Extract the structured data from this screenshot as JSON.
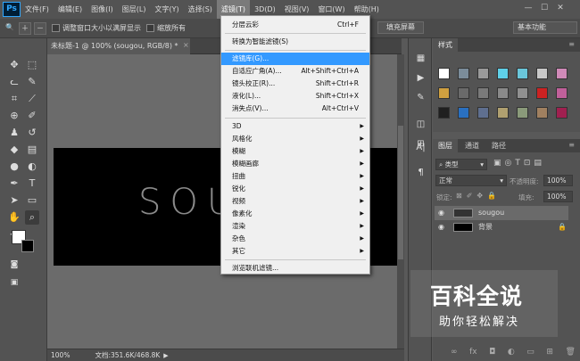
{
  "app": {
    "logo": "Ps"
  },
  "menubar": {
    "items": [
      "文件(F)",
      "编辑(E)",
      "图像(I)",
      "图层(L)",
      "文字(Y)",
      "选择(S)",
      "滤镜(T)",
      "3D(D)",
      "视图(V)",
      "窗口(W)",
      "帮助(H)"
    ],
    "active_index": 6,
    "window_controls": [
      "—",
      "☐",
      "✕"
    ]
  },
  "options_bar": {
    "zoom_glyph": "🔍",
    "resize_windows_label": "调整窗口大小以满屏显示",
    "zoom_all_label": "缩放所有",
    "fill_screen_button": "填充屏幕",
    "workspace_select": "基本功能"
  },
  "document": {
    "tab_title": "未标题-1 @ 100% (sougou, RGB/8) *",
    "canvas_text": "SOU",
    "zoom_status": "100%",
    "doc_status": "文档:351.6K/468.8K"
  },
  "filter_menu": {
    "items": [
      {
        "label": "分层云彩",
        "shortcut": "Ctrl+F"
      },
      {
        "label": "转换为智能滤镜(S)",
        "shortcut": ""
      },
      {
        "label": "滤镜库(G)...",
        "shortcut": "",
        "highlighted": true
      },
      {
        "label": "自适应广角(A)...",
        "shortcut": "Alt+Shift+Ctrl+A"
      },
      {
        "label": "镜头校正(R)...",
        "shortcut": "Shift+Ctrl+R"
      },
      {
        "label": "液化(L)...",
        "shortcut": "Shift+Ctrl+X"
      },
      {
        "label": "消失点(V)...",
        "shortcut": "Alt+Ctrl+V"
      },
      {
        "label": "3D",
        "shortcut": "",
        "submenu": true
      },
      {
        "label": "风格化",
        "shortcut": "",
        "submenu": true
      },
      {
        "label": "模糊",
        "shortcut": "",
        "submenu": true
      },
      {
        "label": "模糊画廊",
        "shortcut": "",
        "submenu": true
      },
      {
        "label": "扭曲",
        "shortcut": "",
        "submenu": true
      },
      {
        "label": "锐化",
        "shortcut": "",
        "submenu": true
      },
      {
        "label": "视频",
        "shortcut": "",
        "submenu": true
      },
      {
        "label": "像素化",
        "shortcut": "",
        "submenu": true
      },
      {
        "label": "渲染",
        "shortcut": "",
        "submenu": true
      },
      {
        "label": "杂色",
        "shortcut": "",
        "submenu": true
      },
      {
        "label": "其它",
        "shortcut": "",
        "submenu": true
      },
      {
        "label": "浏览联机滤镜...",
        "shortcut": ""
      }
    ]
  },
  "styles_panel": {
    "tab": "样式",
    "swatch_colors": [
      "#ffffff",
      "#7b8c9a",
      "#9a9a9a",
      "#5fd0e8",
      "#6ac6da",
      "#c8c8c8",
      "#d08ab8",
      "#d0a040",
      "#6a6a6a",
      "#7a7a7a",
      "#8a8a8a",
      "#909090",
      "#cc2222",
      "#c0609a",
      "#202020",
      "#2a70c0",
      "#5f6f8f",
      "#b0a070",
      "#8a9a7a",
      "#a08060",
      "#a02050"
    ]
  },
  "layers_panel": {
    "tabs": [
      "图层",
      "通道",
      "路径"
    ],
    "kind_filter": "类型",
    "blend_mode": "正常",
    "opacity_label": "不透明度:",
    "opacity_value": "100%",
    "lock_label": "锁定:",
    "fill_label": "填充:",
    "fill_value": "100%",
    "layers": [
      {
        "name": "sougou",
        "kind": "text"
      },
      {
        "name": "背景",
        "kind": "background"
      }
    ]
  },
  "watermark": {
    "title": "百科全说",
    "subtitle": "助你轻松解决"
  }
}
